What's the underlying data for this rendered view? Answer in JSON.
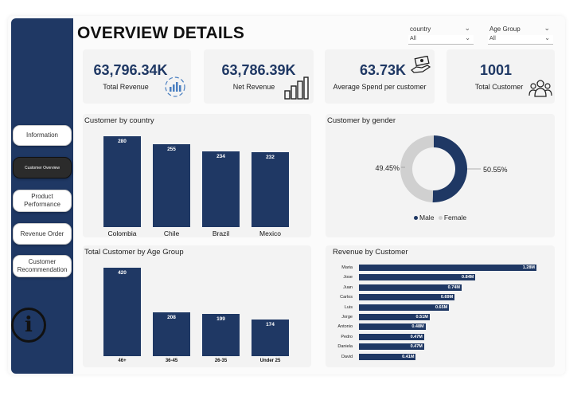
{
  "page": {
    "title": "OVERVIEW DETAILS"
  },
  "colors": {
    "navy": "#1f3864",
    "grey": "#d0d0d0"
  },
  "nav": [
    {
      "label": "Information",
      "active": false
    },
    {
      "label": "Customer Overview",
      "active": true
    },
    {
      "label": "Product Performance",
      "active": false
    },
    {
      "label": "Revenue Order",
      "active": false
    },
    {
      "label": "Customer Recommendation",
      "active": false
    }
  ],
  "filters": {
    "country": {
      "label": "country",
      "value": "All"
    },
    "age_group": {
      "label": "Age Group",
      "value": "All"
    }
  },
  "kpis": [
    {
      "value": "63,796.34K",
      "label": "Total Revenue",
      "icon": "revenue-chart-icon"
    },
    {
      "value": "63,786.39K",
      "label": "Net Revenue",
      "icon": "bar-chart-icon"
    },
    {
      "value": "63.73K",
      "label": "Average Spend per customer",
      "icon": "money-hand-icon"
    },
    {
      "value": "1001",
      "label": "Total Customer",
      "icon": "people-group-icon"
    }
  ],
  "chart_data": [
    {
      "type": "bar",
      "title": "Customer by country",
      "categories": [
        "Colombia",
        "Chile",
        "Brazil",
        "Mexico"
      ],
      "values": [
        280,
        255,
        234,
        232
      ],
      "data_labels": [
        "280",
        "255",
        "234",
        "232"
      ]
    },
    {
      "type": "pie",
      "title": "Customer by gender",
      "labels": [
        "Male",
        "Female"
      ],
      "values": [
        50.55,
        49.45
      ],
      "value_labels": [
        "50.55%",
        "49.45%"
      ],
      "colors": [
        "#1f3864",
        "#d0d0d0"
      ],
      "legend": "bottom"
    },
    {
      "type": "bar",
      "title": "Total Customer by Age Group",
      "categories": [
        "46+",
        "36-45",
        "26-35",
        "Under 25"
      ],
      "values": [
        420,
        208,
        199,
        174
      ],
      "data_labels": [
        "420",
        "208",
        "199",
        "174"
      ]
    },
    {
      "type": "bar",
      "orientation": "horizontal",
      "title": "Revenue by Customer",
      "categories": [
        "Maria",
        "Jose",
        "Juan",
        "Carlos",
        "Luis",
        "Jorge",
        "Antonio",
        "Pedro",
        "Daniela",
        "David"
      ],
      "values": [
        1.28,
        0.84,
        0.74,
        0.69,
        0.65,
        0.51,
        0.48,
        0.47,
        0.47,
        0.41
      ],
      "data_labels": [
        "1.28M",
        "0.84M",
        "0.74M",
        "0.69M",
        "0.65M",
        "0.51M",
        "0.48M",
        "0.47M",
        "0.47M",
        "0.41M"
      ]
    }
  ]
}
